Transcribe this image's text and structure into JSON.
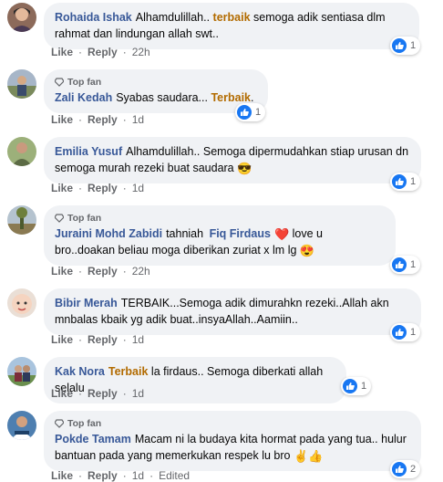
{
  "comments": [
    {
      "author": "Rohaida Ishak",
      "top_fan": "",
      "text1": "Alhamdulillah..",
      "tag": "terbaik",
      "text2": " semoga adik sentiasa dlm rahmat dan lindungan allah swt..",
      "emoji": "",
      "reactions": "1",
      "like": "Like",
      "reply": "Reply",
      "time": "22h",
      "edited": ""
    },
    {
      "author": "Zali Kedah",
      "top_fan": "Top fan",
      "text1": "Syabas saudara...",
      "tag": "Terbaik",
      "text2": ".",
      "emoji": "",
      "reactions": "1",
      "like": "Like",
      "reply": "Reply",
      "time": "1d",
      "edited": ""
    },
    {
      "author": "Emilia Yusuf",
      "top_fan": "",
      "text1": "Alhamdulillah.. Semoga dipermudahkan stiap urusan dn semoga murah rezeki buat saudara",
      "tag": "",
      "text2": "",
      "emoji": "😎",
      "reactions": "1",
      "like": "Like",
      "reply": "Reply",
      "time": "1d",
      "edited": ""
    },
    {
      "author": "Juraini Mohd Zabidi",
      "top_fan": "Top fan",
      "text1": "tahniah",
      "mention": "Fiq Firdaus",
      "heart": "❤️",
      "text2": " love u bro..doakan beliau moga diberikan zuriat x lm lg",
      "emoji": "😍",
      "reactions": "1",
      "like": "Like",
      "reply": "Reply",
      "time": "22h",
      "edited": ""
    },
    {
      "author": "Bibir Merah",
      "top_fan": "",
      "text1": "TERBAIK...Semoga adik dimurahkn rezeki..Allah akn mnbalas kbaik yg adik buat..insyaAllah..Aamiin..",
      "tag": "",
      "text2": "",
      "emoji": "",
      "reactions": "1",
      "like": "Like",
      "reply": "Reply",
      "time": "1d",
      "edited": ""
    },
    {
      "author": "Kak Nora",
      "top_fan": "",
      "text1": "",
      "tag": "Terbaik",
      "text2": " la firdaus.. Semoga diberkati allah selalu",
      "emoji": "",
      "reactions": "1",
      "like": "Like",
      "reply": "Reply",
      "time": "1d",
      "edited": ""
    },
    {
      "author": "Pokde Tamam",
      "top_fan": "Top fan",
      "text1": "Macam ni la budaya kita hormat pada yang tua.. hulur bantuan pada yang memerkukan respek lu bro",
      "tag": "",
      "text2": "",
      "emoji": "✌️👍",
      "reactions": "2",
      "like": "Like",
      "reply": "Reply",
      "time": "1d",
      "edited": "Edited"
    }
  ],
  "colors": {
    "bubble": "#f0f2f5",
    "name": "#385898",
    "tag": "#b26b00",
    "like_blue": "#1877f2",
    "meta": "#65676b"
  },
  "icons": {
    "reaction": "like-thumb-icon",
    "top_fan": "diamond-badge-icon"
  }
}
